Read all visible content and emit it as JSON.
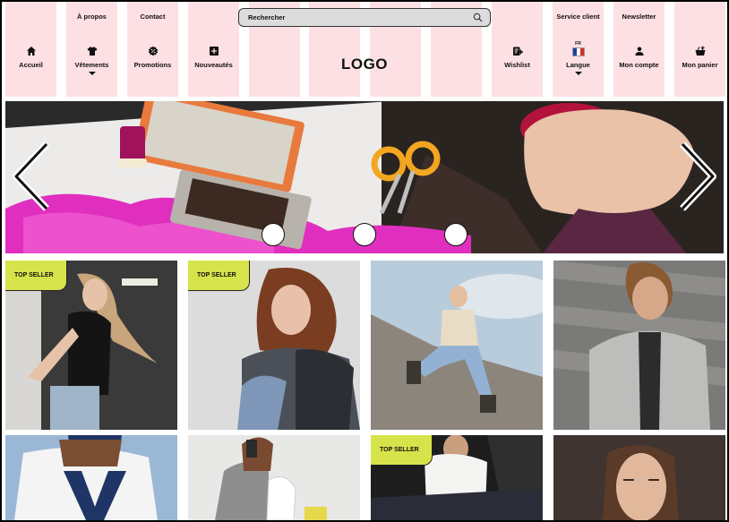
{
  "header": {
    "search": {
      "placeholder": "Rechercher"
    },
    "logo": "LOGO",
    "top_links": {
      "about": "À propos",
      "contact": "Contact",
      "service": "Service client",
      "newsletter": "Newsletter"
    },
    "nav": {
      "home": "Accueil",
      "clothing": "Vêtements",
      "promotions": "Promotions",
      "new": "Nouveautés",
      "wishlist": "Wishlist",
      "language": "Langue",
      "language_code": "FR",
      "account": "Mon compte",
      "cart": "Mon panier"
    }
  },
  "banner": {
    "slide_count": 3
  },
  "products": {
    "badge_label": "TOP SELLER",
    "tiles": [
      {
        "badge": true
      },
      {
        "badge": true
      },
      {
        "badge": false
      },
      {
        "badge": false
      },
      {
        "badge": false
      },
      {
        "badge": false
      },
      {
        "badge": true
      },
      {
        "badge": false
      }
    ]
  },
  "colors": {
    "header_column": "#fde0e3",
    "badge": "#d7e34a"
  }
}
